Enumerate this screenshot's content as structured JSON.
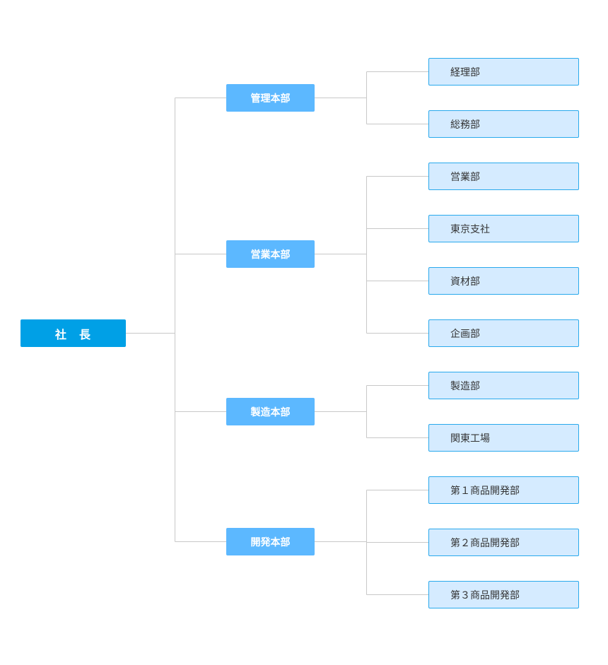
{
  "root": {
    "label": "社　長"
  },
  "divisions": [
    {
      "label": "管理本部",
      "departments": [
        "経理部",
        "総務部"
      ]
    },
    {
      "label": "営業本部",
      "departments": [
        "営業部",
        "東京支社",
        "資材部",
        "企画部"
      ]
    },
    {
      "label": "製造本部",
      "departments": [
        "製造部",
        "関東工場"
      ]
    },
    {
      "label": "開発本部",
      "departments": [
        "第１商品開発部",
        "第２商品開発部",
        "第３商品開発部"
      ]
    }
  ],
  "colors": {
    "root": "#00a0e6",
    "division": "#5cb8ff",
    "department": "#d5ebff",
    "department_border": "#29a9ec",
    "connector": "#c8c8c8"
  }
}
